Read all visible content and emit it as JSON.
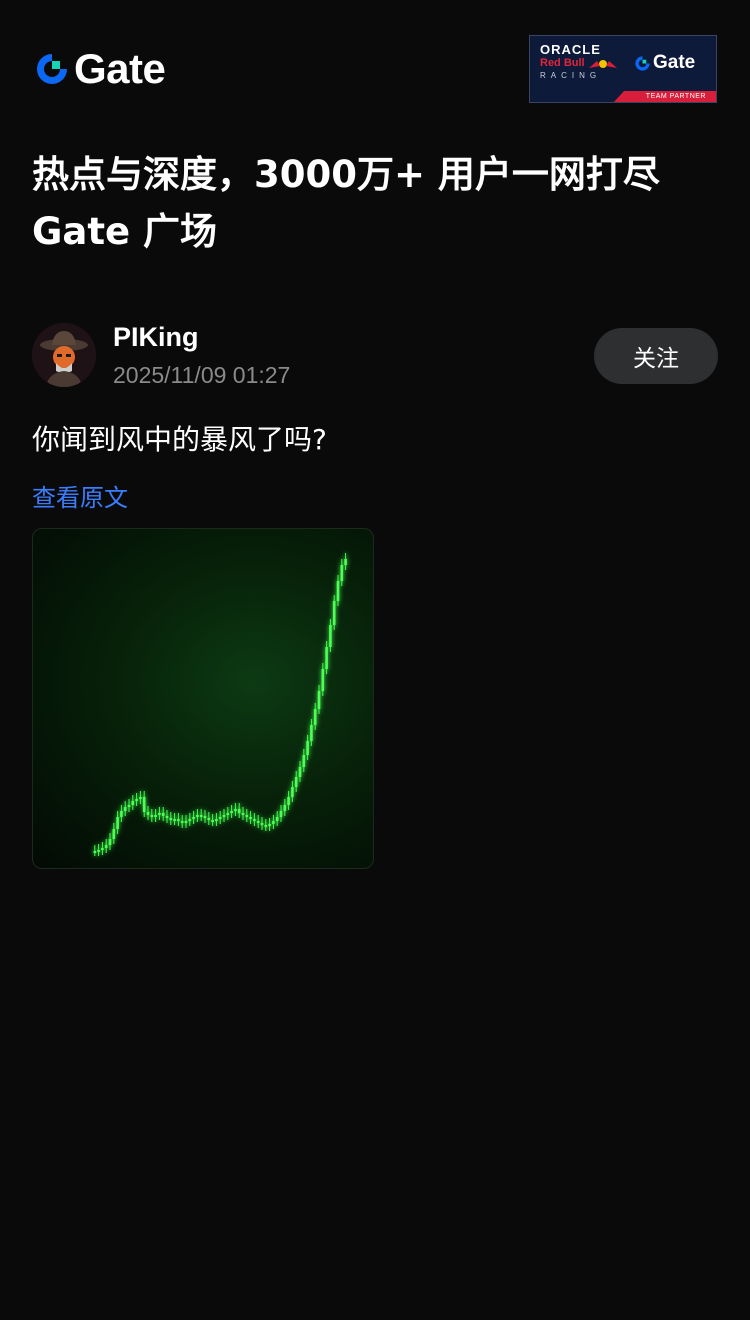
{
  "header": {
    "brand_name": "Gate",
    "brand_accent_color": "#0a68f4",
    "brand_teal_color": "#13d6b8",
    "partner_banner": {
      "oracle": "ORACLE",
      "redbull": "Red Bull",
      "racing": "RACING",
      "partner_brand": "Gate",
      "team_partner": "TEAM PARTNER"
    }
  },
  "headline": {
    "line1": "热点与深度，3000万+ 用户一网打尽",
    "line2": "Gate 广场"
  },
  "post": {
    "author": "PIKing",
    "timestamp": "2025/11/09 01:27",
    "follow_label": "关注",
    "text": "你闻到风中的暴风了吗?",
    "view_original_label": "查看原文",
    "link_color": "#3a7dff",
    "image_icon": "green-candlestick-chart-image"
  }
}
